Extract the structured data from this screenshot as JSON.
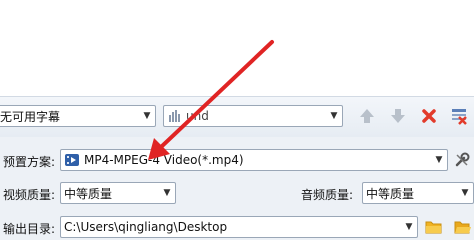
{
  "toolbar": {
    "subtitle_select_value": "无可用字幕",
    "audio_track_select_value": "und"
  },
  "settings": {
    "preset_label": "预置方案:",
    "preset_value": "MP4-MPEG-4 Video(*.mp4)",
    "video_quality_label": "视频质量:",
    "video_quality_value": "中等质量",
    "audio_quality_label": "音频质量:",
    "audio_quality_value": "中等质量",
    "output_dir_label": "输出目录:",
    "output_dir_value": "C:\\Users\\qingliang\\Desktop"
  },
  "colors": {
    "annotation_arrow": "#e02424",
    "delete_icon": "#e23b2b",
    "folder_icon": "#f0b323"
  }
}
